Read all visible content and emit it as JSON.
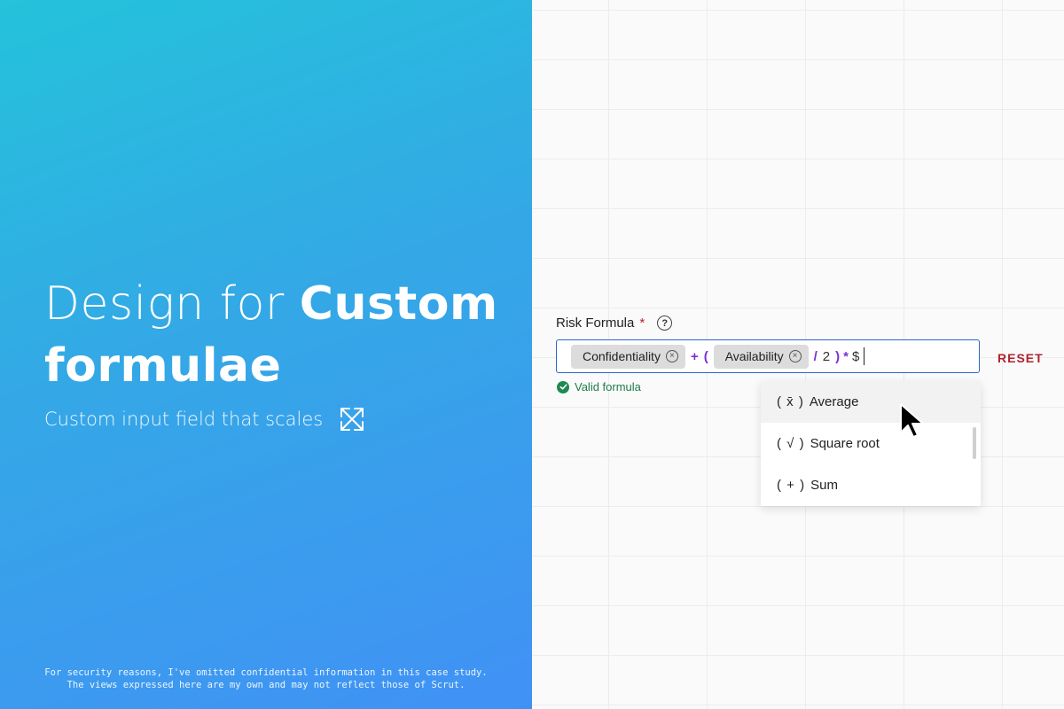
{
  "hero": {
    "title_light": "Design for ",
    "title_bold_1": "Custom",
    "title_bold_2": "formulae",
    "subtitle": "Custom input field that scales",
    "icon": "expand-arrows-icon"
  },
  "disclaimer": {
    "line1": "For security reasons, I've omitted confidential information in this case study.",
    "line2": "The views expressed here are my own and may not reflect those of Scrut."
  },
  "form": {
    "label": "Risk Formula",
    "required_mark": "*",
    "help_glyph": "?",
    "tokens": {
      "chip1": "Confidentiality",
      "op_plus": "+",
      "op_open": "(",
      "chip2": "Availability",
      "op_div": "/",
      "num": "2",
      "op_close": ")",
      "op_mul": "*",
      "var": "$"
    },
    "reset_label": "RESET",
    "valid_text": "Valid formula"
  },
  "dropdown": {
    "options": [
      {
        "symbol": "( x̄ )",
        "label": "Average"
      },
      {
        "symbol": "( √ )",
        "label": "Square root"
      },
      {
        "symbol": "( + )",
        "label": "Sum"
      }
    ]
  },
  "colors": {
    "accent": "#2b66c9",
    "operator": "#7a2fd6",
    "reset": "#b0232e",
    "valid": "#1d7a4a"
  }
}
